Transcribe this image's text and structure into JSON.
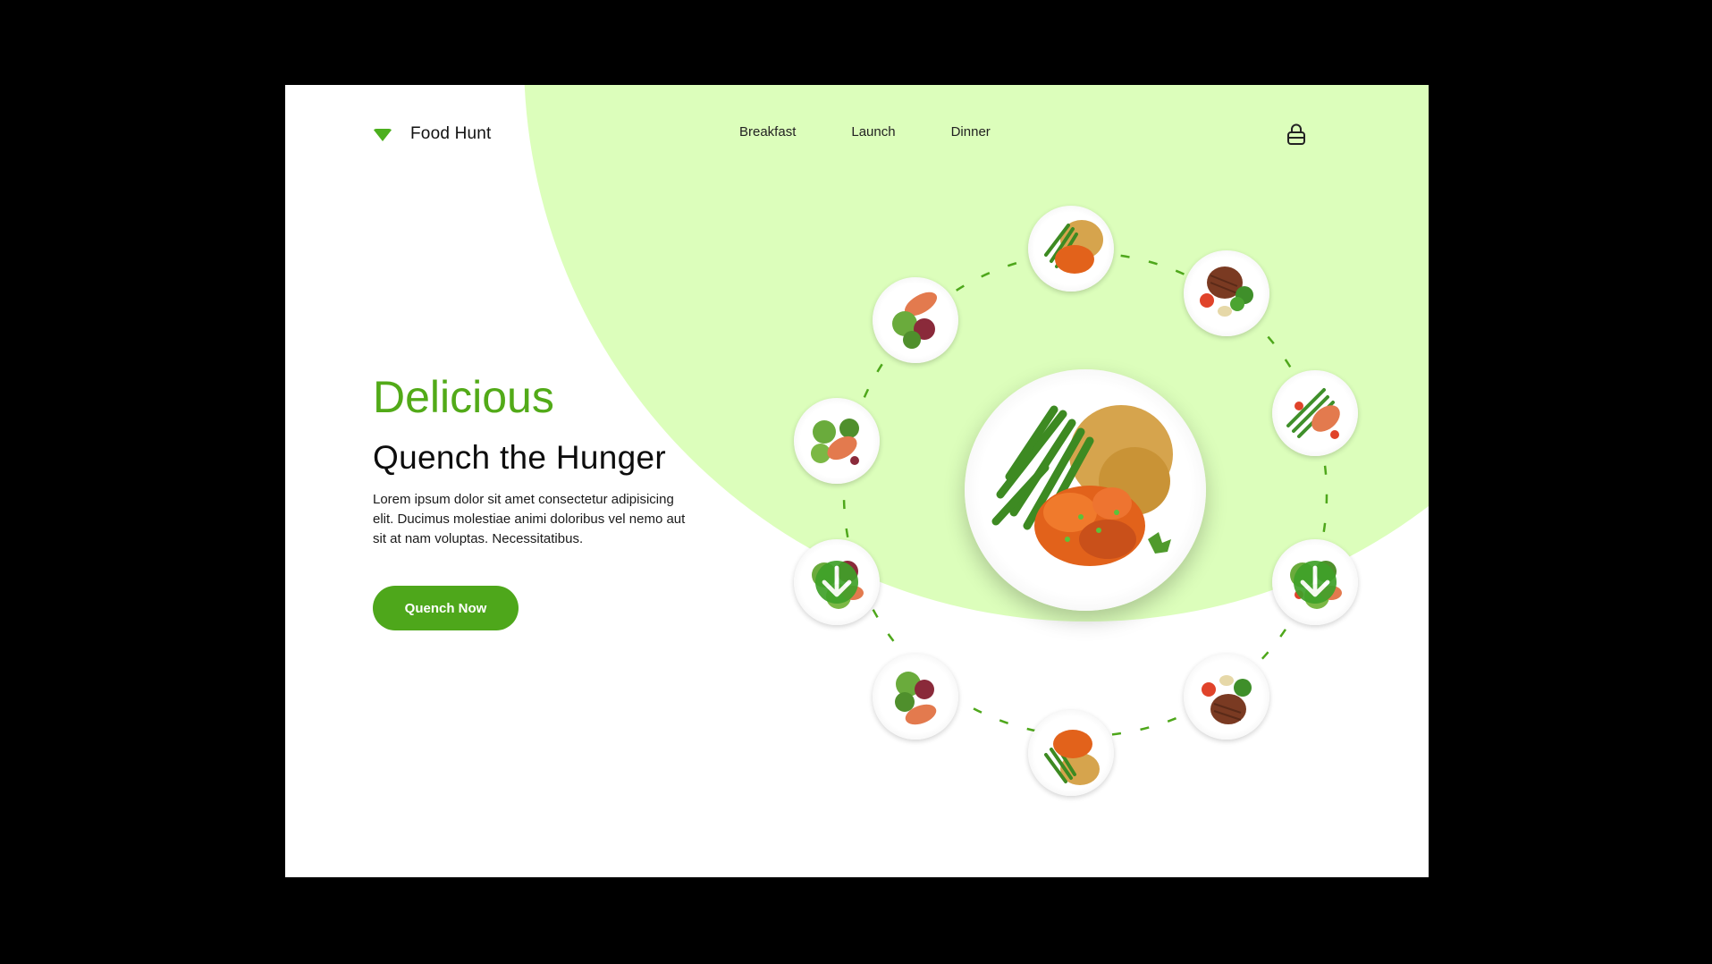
{
  "brand": {
    "name": "Food Hunt",
    "icon": "bowl-icon",
    "accent": "#4ea71b",
    "tint": "#dcfebb"
  },
  "nav": {
    "items": [
      {
        "label": "Breakfast"
      },
      {
        "label": "Launch"
      },
      {
        "label": "Dinner"
      }
    ],
    "account_icon": "lock-icon"
  },
  "hero": {
    "tagline": "Delicious",
    "title": "Quench the Hunger",
    "body": "Lorem ipsum dolor sit amet consectetur adipisicing elit. Ducimus molestiae animi doloribus vel nemo aut sit at nam voluptas. Necessitatibus.",
    "cta_label": "Quench Now"
  },
  "carousel": {
    "main_dish": "chicken-rice-greenbeans",
    "dishes": [
      "chicken-rice-greenbeans",
      "steak-broccoli",
      "salmon-asparagus",
      "salad-download",
      "steak-broccoli",
      "chicken-rice-greenbeans",
      "salad-salmon",
      "salad-download",
      "salmon-salad",
      "salmon-salad"
    ],
    "download_icon": "arrow-down-icon"
  }
}
